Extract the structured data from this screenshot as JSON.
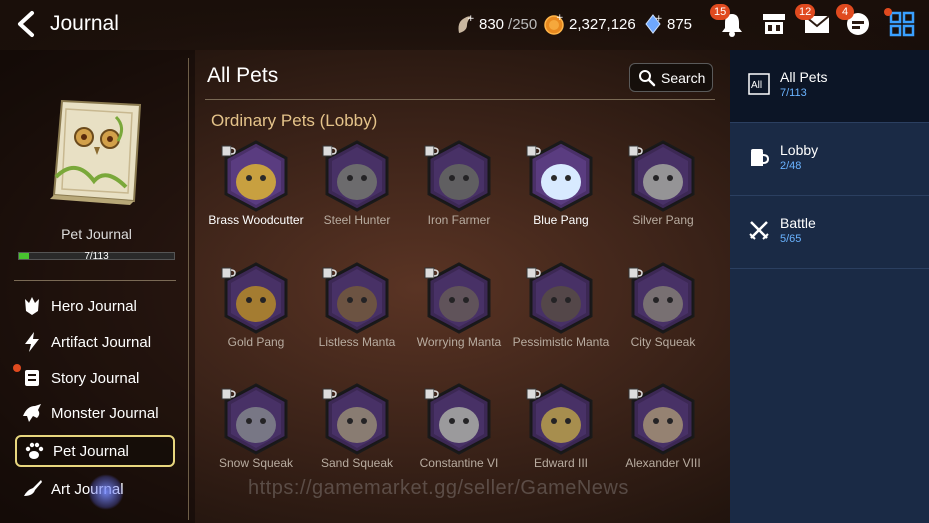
{
  "header": {
    "title": "Journal",
    "stamina": {
      "value": "830",
      "max": "/250"
    },
    "gold": "2,327,126",
    "crystals": "875",
    "notifications_badge": "15",
    "mail_badge": "12",
    "chat_badge": "4"
  },
  "left": {
    "book_label": "Pet Journal",
    "progress_text": "7/113",
    "progress_fraction": 0.062,
    "nav": [
      {
        "label": "Hero Journal"
      },
      {
        "label": "Artifact Journal"
      },
      {
        "label": "Story Journal"
      },
      {
        "label": "Monster Journal"
      },
      {
        "label": "Pet Journal"
      },
      {
        "label": "Art Journal"
      }
    ]
  },
  "main": {
    "title": "All Pets",
    "search_label": "Search",
    "section_title": "Ordinary Pets (Lobby)",
    "pets": [
      {
        "name": "Brass Woodcutter",
        "owned": true
      },
      {
        "name": "Steel Hunter",
        "owned": false
      },
      {
        "name": "Iron Farmer",
        "owned": false
      },
      {
        "name": "Blue Pang",
        "owned": true
      },
      {
        "name": "Silver Pang",
        "owned": false
      },
      {
        "name": "Gold Pang",
        "owned": false
      },
      {
        "name": "Listless Manta",
        "owned": false
      },
      {
        "name": "Worrying Manta",
        "owned": false
      },
      {
        "name": "Pessimistic Manta",
        "owned": false
      },
      {
        "name": "City Squeak",
        "owned": false
      },
      {
        "name": "Snow Squeak",
        "owned": false
      },
      {
        "name": "Sand Squeak",
        "owned": false
      },
      {
        "name": "Constantine VI",
        "owned": false
      },
      {
        "name": "Edward III",
        "owned": false
      },
      {
        "name": "Alexander VIII",
        "owned": false
      }
    ]
  },
  "watermark": "https://gamemarket.gg/seller/GameNews",
  "right": {
    "tabs": [
      {
        "name": "All Pets",
        "count": "7/113",
        "icon_text": "All"
      },
      {
        "name": "Lobby",
        "count": "2/48"
      },
      {
        "name": "Battle",
        "count": "5/65"
      }
    ]
  },
  "colors": {
    "accent_gold": "#e8d67e",
    "count_blue": "#6ab3ff",
    "badge_red": "#e04a1f",
    "progress_green": "#48c22f"
  }
}
